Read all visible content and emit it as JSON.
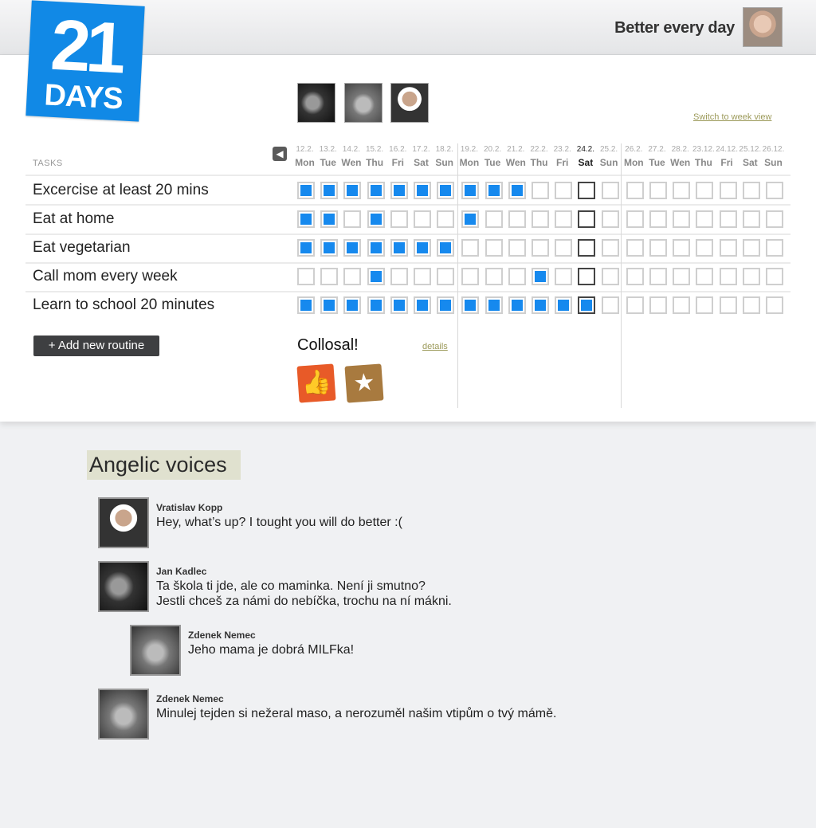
{
  "logo": {
    "number": "21",
    "word": "DAYS"
  },
  "header": {
    "tagline": "Better every day"
  },
  "friends": [
    "friend-1",
    "friend-2",
    "friend-3"
  ],
  "switch_view": "Switch to week view",
  "tasks_header": "TASKS",
  "days": [
    {
      "date": "12.2.",
      "day": "Mon"
    },
    {
      "date": "13.2.",
      "day": "Tue"
    },
    {
      "date": "14.2.",
      "day": "Wen"
    },
    {
      "date": "15.2.",
      "day": "Thu"
    },
    {
      "date": "16.2.",
      "day": "Fri"
    },
    {
      "date": "17.2.",
      "day": "Sat"
    },
    {
      "date": "18.2.",
      "day": "Sun"
    },
    {
      "date": "19.2.",
      "day": "Mon"
    },
    {
      "date": "20.2.",
      "day": "Tue"
    },
    {
      "date": "21.2.",
      "day": "Wen"
    },
    {
      "date": "22.2.",
      "day": "Thu"
    },
    {
      "date": "23.2.",
      "day": "Fri"
    },
    {
      "date": "24.2.",
      "day": "Sat"
    },
    {
      "date": "25.2.",
      "day": "Sun"
    },
    {
      "date": "26.2.",
      "day": "Mon"
    },
    {
      "date": "27.2.",
      "day": "Tue"
    },
    {
      "date": "28.2.",
      "day": "Wen"
    },
    {
      "date": "23.12.",
      "day": "Thu"
    },
    {
      "date": "24.12.",
      "day": "Fri"
    },
    {
      "date": "25.12.",
      "day": "Sat"
    },
    {
      "date": "26.12.",
      "day": "Sun"
    }
  ],
  "today_index": 12,
  "tasks": [
    {
      "name": "Excercise at least 20 mins",
      "done": [
        1,
        1,
        1,
        1,
        1,
        1,
        1,
        1,
        1,
        1,
        0,
        0,
        0,
        0,
        0,
        0,
        0,
        0,
        0,
        0,
        0
      ]
    },
    {
      "name": "Eat at home",
      "done": [
        1,
        1,
        0,
        1,
        0,
        0,
        0,
        1,
        0,
        0,
        0,
        0,
        0,
        0,
        0,
        0,
        0,
        0,
        0,
        0,
        0
      ]
    },
    {
      "name": "Eat vegetarian",
      "done": [
        1,
        1,
        1,
        1,
        1,
        1,
        1,
        0,
        0,
        0,
        0,
        0,
        0,
        0,
        0,
        0,
        0,
        0,
        0,
        0,
        0
      ]
    },
    {
      "name": "Call mom every week",
      "done": [
        0,
        0,
        0,
        1,
        0,
        0,
        0,
        0,
        0,
        0,
        1,
        0,
        0,
        0,
        0,
        0,
        0,
        0,
        0,
        0,
        0
      ]
    },
    {
      "name": "Learn to school 20 minutes",
      "done": [
        1,
        1,
        1,
        1,
        1,
        1,
        1,
        1,
        1,
        1,
        1,
        1,
        1,
        0,
        0,
        0,
        0,
        0,
        0,
        0,
        0
      ]
    }
  ],
  "add_routine": "+ Add new routine",
  "result": {
    "label": "Collosal!",
    "details": "details"
  },
  "badges": {
    "thumbs": "👍",
    "star": "★"
  },
  "colors": {
    "brand": "#1189e6",
    "check": "#1689ee"
  },
  "voices": {
    "title": "Angelic voices",
    "comments": [
      {
        "name": "Vratislav Kopp",
        "text": "Hey, what’s up? I tought you will do better :("
      },
      {
        "name": "Jan Kadlec",
        "text": "Ta škola ti jde, ale co maminka. Není ji smutno?\nJestli chceš za námi do nebíčka, trochu na ní mákni."
      },
      {
        "name": "Zdenek Nemec",
        "text": "Jeho mama je dobrá MILFka!"
      },
      {
        "name": "Zdenek Nemec",
        "text": "Minulej tejden si nežeral maso, a nerozuměl našim vtipům o tvý mámě."
      }
    ]
  }
}
